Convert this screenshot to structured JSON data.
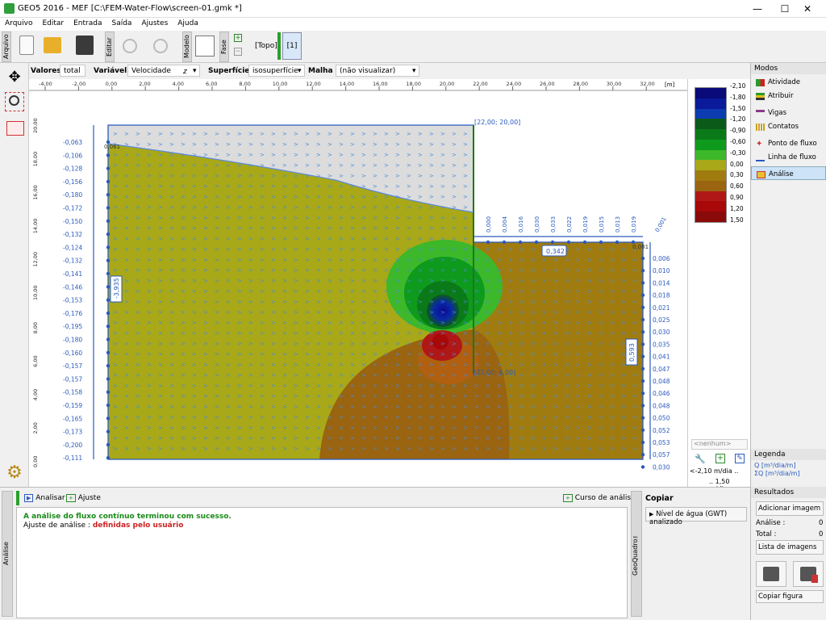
{
  "window": {
    "title": "GEO5 2016 - MEF [C:\\FEM-Water-Flow\\screen-01.gmk *]",
    "minimize": "—",
    "maximize": "☐",
    "close": "✕"
  },
  "menu": [
    "Arquivo",
    "Editar",
    "Entrada",
    "Saída",
    "Ajustes",
    "Ajuda"
  ],
  "toolbar": {
    "arquivo_tab": "Arquivo",
    "editar_tab": "Editar",
    "modelo_tab": "Modelo",
    "fase_tab": "Fase",
    "topo_label": "[Topo]",
    "phase_label": "[1]"
  },
  "options": {
    "valores_label": "Valores :",
    "valores_value": "total",
    "variavel_label": "Variável :",
    "variavel_value": "Velocidade",
    "variavel_sub": "z",
    "superficie_label": "Superfície :",
    "superficie_value": "isosuperfície",
    "malha_label": "Malha :",
    "malha_value": "(não visualizar)"
  },
  "ruler": {
    "ticks": [
      "-4,00",
      "-2,00",
      "0,00",
      "2,00",
      "4,00",
      "6,00",
      "8,00",
      "10,00",
      "12,00",
      "14,00",
      "16,00",
      "18,00",
      "20,00",
      "22,00",
      "24,00",
      "26,00",
      "28,00",
      "30,00",
      "32,00"
    ],
    "unit": "[m]",
    "yticks": [
      "20,00",
      "18,00",
      "16,00",
      "14,00",
      "12,00",
      "10,00",
      "8,00",
      "6,00",
      "4,00",
      "2,00",
      "0,00"
    ]
  },
  "model": {
    "left_values": [
      "-0,063",
      "-0,106",
      "-0,128",
      "-0,156",
      "-0,180",
      "-0,172",
      "-0,150",
      "-0,132",
      "-0,124",
      "-0,132",
      "-0,141",
      "-0,146",
      "-0,153",
      "-0,176",
      "-0,195",
      "-0,180",
      "-0,160",
      "-0,157",
      "-0,157",
      "-0,158",
      "-0,159",
      "-0,165",
      "-0,173",
      "-0,200",
      "-0,111"
    ],
    "right_values": [
      "0,006",
      "0,010",
      "0,014",
      "0,018",
      "0,021",
      "0,025",
      "0,030",
      "0,035",
      "0,041",
      "0,047",
      "0,048",
      "0,046",
      "0,048",
      "0,050",
      "0,052",
      "0,053",
      "0,057",
      "0,030"
    ],
    "top_values": [
      "0,000",
      "0,004",
      "0,016",
      "0,030",
      "0,033",
      "0,022",
      "0,019",
      "0,015",
      "0,013",
      "0,019"
    ],
    "coord_top": "[22,00; 20,00]",
    "coord_bottom": "[22,00; 6,00]",
    "left_sum": "-3,935",
    "right_sum": "0,593",
    "top_sum": "0,342",
    "wall_label": "1,00E+00",
    "node_label_l": "0,061",
    "node_label_r": "0,081",
    "corner_label": "0,001"
  },
  "legend": {
    "values": [
      "-2,10",
      "-1,80",
      "-1,50",
      "-1,20",
      "-0,90",
      "-0,60",
      "-0,30",
      "0,00",
      "0,30",
      "0,60",
      "0,90",
      "1,20",
      "1,50"
    ],
    "colors": [
      "#0a0a7a",
      "#0a1a9a",
      "#0c3cb0",
      "#0c5a1a",
      "#0a7a18",
      "#0e9a1c",
      "#3cb82a",
      "#a8a818",
      "#a07c10",
      "#9a6410",
      "#b01818",
      "#a80808",
      "#8a0a0a"
    ],
    "none_label": "<nenhum>",
    "min_label": "<-2,10 m/dia ..",
    "max_label": ".. 1,50 m/dia>"
  },
  "modes": {
    "header": "Modos",
    "items": [
      "Atividade",
      "Atribuir",
      "Vigas",
      "Contatos",
      "Ponto de fluxo",
      "Linha de fluxo",
      "Análise"
    ]
  },
  "legenda": {
    "header": "Legenda",
    "q": "Q [m³/dia/m]",
    "sq": "ΣQ [m³/dia/m]"
  },
  "resultados": {
    "header": "Resultados",
    "add": "Adicionar imagem",
    "analise_label": "Análise :",
    "analise_val": "0",
    "total_label": "Total :",
    "total_val": "0",
    "list": "Lista de imagens",
    "copy": "Copiar figura"
  },
  "bottom": {
    "analisar": "Analisar",
    "ajuste": "Ajuste",
    "curso": "Curso de análise",
    "msg1": "A análise do fluxo contínuo terminou com sucesso.",
    "msg2a": "Ajuste de análise : ",
    "msg2b": "definidas pelo usuário",
    "vtab_left": "Análise",
    "vtab_right": "GeoQuadro™",
    "copiar": "Copiar",
    "nivel": "Nível de água (GWT) analizado"
  }
}
